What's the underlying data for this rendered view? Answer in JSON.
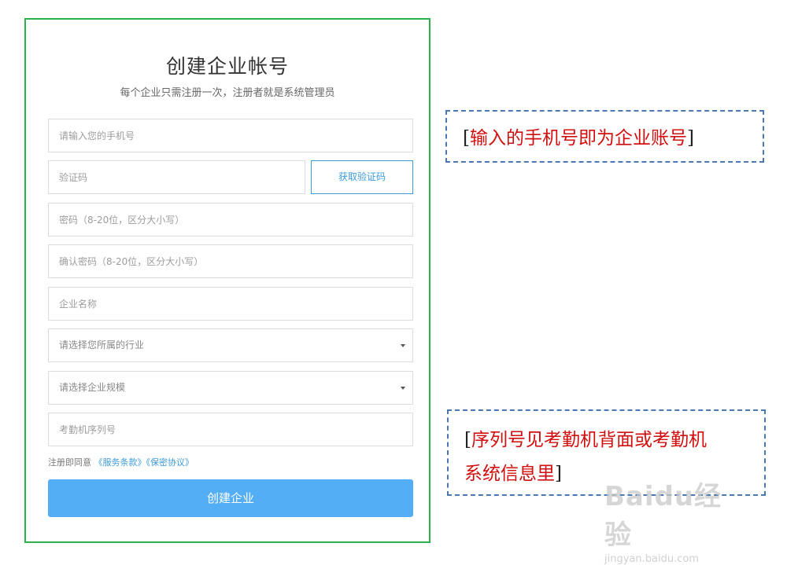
{
  "form": {
    "title": "创建企业帐号",
    "subtitle": "每个企业只需注册一次，注册者就是系统管理员",
    "phone_placeholder": "请输入您的手机号",
    "code_placeholder": "验证码",
    "get_code_label": "获取验证码",
    "password_placeholder": "密码（8-20位，区分大小写）",
    "confirm_password_placeholder": "确认密码（8-20位，区分大小写）",
    "company_name_placeholder": "企业名称",
    "industry_select": "请选择您所属的行业",
    "scale_select": "请选择企业规模",
    "serial_placeholder": "考勤机序列号",
    "agree_prefix": "注册即同意",
    "terms_link": "《服务条款》",
    "privacy_link": "《保密协议》",
    "submit_label": "创建企业"
  },
  "annotations": {
    "phone_note": "输入的手机号即为企业账号",
    "serial_note_line1": "序列号见考勤机背面或考勤机",
    "serial_note_line2": "系统信息里",
    "bracket_open": "[",
    "bracket_close": "]"
  },
  "watermark": {
    "logo": "Baidu经验",
    "url": "jingyan.baidu.com"
  },
  "colors": {
    "card_border": "#2eb04d",
    "accent": "#3e9bd8",
    "button": "#54aef5",
    "note_text": "#d10f0f",
    "note_border": "#4a78b3"
  }
}
